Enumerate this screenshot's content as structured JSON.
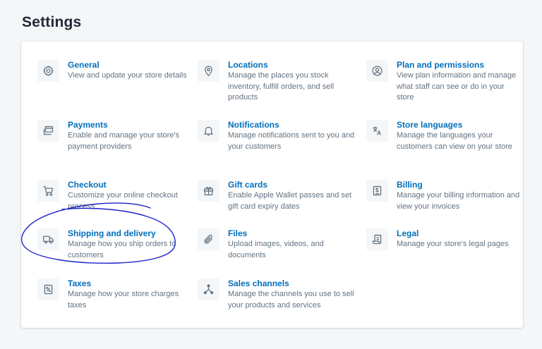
{
  "page": {
    "title": "Settings"
  },
  "settings": [
    {
      "id": "general",
      "icon": "gear-icon",
      "title": "General",
      "description": "View and update your store details"
    },
    {
      "id": "locations",
      "icon": "location-pin-icon",
      "title": "Locations",
      "description": "Manage the places you stock inventory, fulfill orders, and sell products"
    },
    {
      "id": "plan",
      "icon": "user-circle-icon",
      "title": "Plan and permissions",
      "description": "View plan information and manage what staff can see or do in your store"
    },
    {
      "id": "payments",
      "icon": "payments-icon",
      "title": "Payments",
      "description": "Enable and manage your store's payment providers"
    },
    {
      "id": "notifications",
      "icon": "bell-icon",
      "title": "Notifications",
      "description": "Manage notifications sent to you and your customers"
    },
    {
      "id": "languages",
      "icon": "translate-icon",
      "title": "Store languages",
      "description": "Manage the languages your customers can view on your store"
    },
    {
      "id": "checkout",
      "icon": "cart-icon",
      "title": "Checkout",
      "description": "Customize your online checkout process"
    },
    {
      "id": "giftcards",
      "icon": "gift-icon",
      "title": "Gift cards",
      "description": "Enable Apple Wallet passes and set gift card expiry dates"
    },
    {
      "id": "billing",
      "icon": "billing-icon",
      "title": "Billing",
      "description": "Manage your billing information and view your invoices"
    },
    {
      "id": "shipping",
      "icon": "truck-icon",
      "title": "Shipping and delivery",
      "description": "Manage how you ship orders to customers"
    },
    {
      "id": "files",
      "icon": "paperclip-icon",
      "title": "Files",
      "description": "Upload images, videos, and documents"
    },
    {
      "id": "legal",
      "icon": "legal-document-icon",
      "title": "Legal",
      "description": "Manage your store's legal pages"
    },
    {
      "id": "taxes",
      "icon": "tax-icon",
      "title": "Taxes",
      "description": "Manage how your store charges taxes"
    },
    {
      "id": "channels",
      "icon": "sales-channels-icon",
      "title": "Sales channels",
      "description": "Manage the channels you use to sell your products and services"
    }
  ],
  "colors": {
    "link": "#006fbb",
    "description": "#637381",
    "icon": "#637381",
    "annotation": "#1a23c8"
  }
}
